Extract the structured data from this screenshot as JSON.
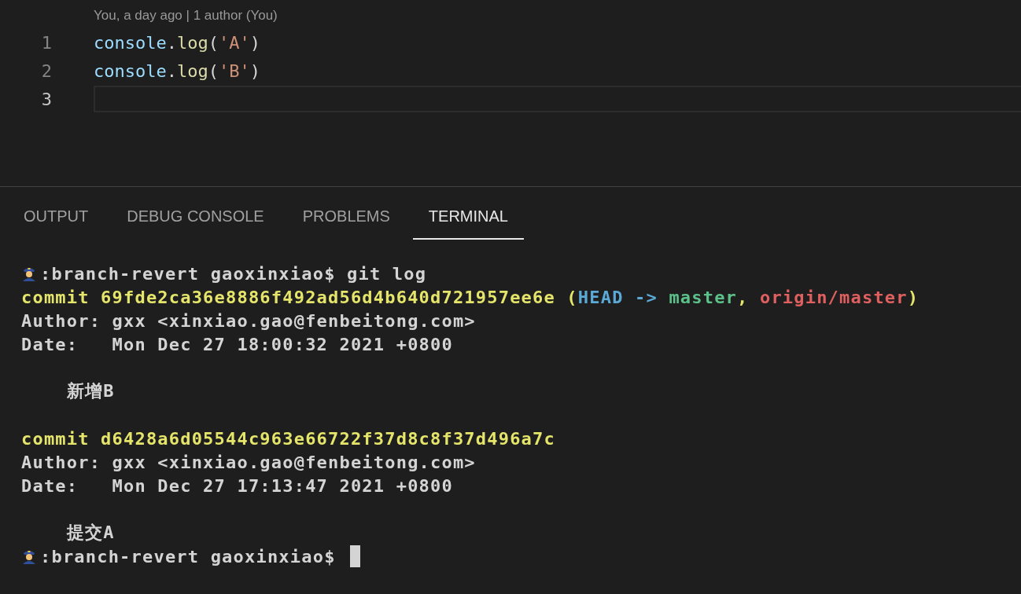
{
  "editor": {
    "codelens": "You, a day ago | 1 author (You)",
    "lines": [
      {
        "number": "1",
        "current": false,
        "tokens": [
          {
            "kind": "variable",
            "text": "console"
          },
          {
            "kind": "punct",
            "text": "."
          },
          {
            "kind": "function",
            "text": "log"
          },
          {
            "kind": "punct",
            "text": "("
          },
          {
            "kind": "string",
            "text": "'A'"
          },
          {
            "kind": "punct",
            "text": ")"
          }
        ]
      },
      {
        "number": "2",
        "current": false,
        "tokens": [
          {
            "kind": "variable",
            "text": "console"
          },
          {
            "kind": "punct",
            "text": "."
          },
          {
            "kind": "function",
            "text": "log"
          },
          {
            "kind": "punct",
            "text": "("
          },
          {
            "kind": "string",
            "text": "'B'"
          },
          {
            "kind": "punct",
            "text": ")"
          }
        ]
      },
      {
        "number": "3",
        "current": true
      }
    ]
  },
  "panel": {
    "tabs": [
      {
        "label": "OUTPUT",
        "selected": false
      },
      {
        "label": "DEBUG CONSOLE",
        "selected": false
      },
      {
        "label": "PROBLEMS",
        "selected": false
      },
      {
        "label": "TERMINAL",
        "selected": true
      }
    ],
    "terminal": [
      {
        "kind": "prompt",
        "segments": [
          {
            "kind": "plain",
            "text": ":branch-revert gaoxinxiao$ git log"
          }
        ]
      },
      {
        "kind": "text",
        "segments": [
          {
            "kind": "commit",
            "text": "commit 69fde2ca36e8886f492ad56d4b640d721957ee6e ("
          },
          {
            "kind": "head",
            "text": "HEAD -> "
          },
          {
            "kind": "branch",
            "text": "master"
          },
          {
            "kind": "commit",
            "text": ", "
          },
          {
            "kind": "remote",
            "text": "origin/master"
          },
          {
            "kind": "commit",
            "text": ")"
          }
        ]
      },
      {
        "kind": "text",
        "segments": [
          {
            "kind": "plain",
            "text": "Author: gxx <xinxiao.gao@fenbeitong.com>"
          }
        ]
      },
      {
        "kind": "text",
        "segments": [
          {
            "kind": "plain",
            "text": "Date:   Mon Dec 27 18:00:32 2021 +0800"
          }
        ]
      },
      {
        "kind": "blank"
      },
      {
        "kind": "text",
        "segments": [
          {
            "kind": "plain",
            "text": "    新增B"
          }
        ]
      },
      {
        "kind": "blank"
      },
      {
        "kind": "text",
        "segments": [
          {
            "kind": "commit",
            "text": "commit d6428a6d05544c963e66722f37d8c8f37d496a7c"
          }
        ]
      },
      {
        "kind": "text",
        "segments": [
          {
            "kind": "plain",
            "text": "Author: gxx <xinxiao.gao@fenbeitong.com>"
          }
        ]
      },
      {
        "kind": "text",
        "segments": [
          {
            "kind": "plain",
            "text": "Date:   Mon Dec 27 17:13:47 2021 +0800"
          }
        ]
      },
      {
        "kind": "blank"
      },
      {
        "kind": "text",
        "segments": [
          {
            "kind": "plain",
            "text": "    提交A"
          }
        ]
      },
      {
        "kind": "prompt",
        "cursor": true,
        "segments": [
          {
            "kind": "plain",
            "text": ":branch-revert gaoxinxiao$ "
          }
        ]
      }
    ]
  }
}
